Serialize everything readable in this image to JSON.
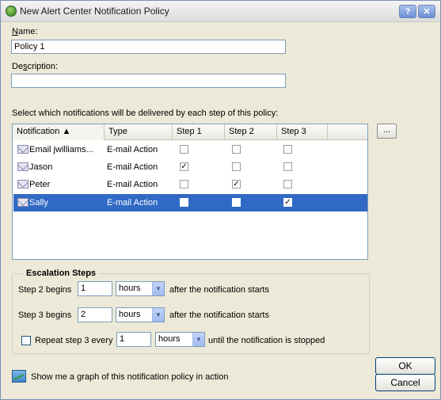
{
  "window": {
    "title": "New Alert Center Notification Policy",
    "help_label": "?",
    "close_label": "✕"
  },
  "name": {
    "label": "Name:",
    "value": "Policy 1"
  },
  "description": {
    "label": "Description:",
    "value": ""
  },
  "instructions": "Select which notifications will be delivered by each step of this policy:",
  "table": {
    "columns": [
      "Notification ▲",
      "Type",
      "Step 1",
      "Step 2",
      "Step 3"
    ],
    "rows": [
      {
        "name": "Email jwilliams...",
        "type": "E-mail Action",
        "step1": "",
        "step2": "",
        "step3": "",
        "selected": false
      },
      {
        "name": "Jason",
        "type": "E-mail Action",
        "step1": "✓",
        "step2": "",
        "step3": "",
        "selected": false
      },
      {
        "name": "Peter",
        "type": "E-mail Action",
        "step1": "",
        "step2": "✓",
        "step3": "",
        "selected": false
      },
      {
        "name": "Sally",
        "type": "E-mail Action",
        "step1": "",
        "step2": "",
        "step3": "✓",
        "selected": true
      }
    ]
  },
  "ellipsis_label": "...",
  "escalation": {
    "title": "Escalation Steps",
    "step2": {
      "label": "Step 2 begins",
      "value": "1",
      "unit": "hours",
      "suffix": "after the notification starts"
    },
    "step3": {
      "label": "Step 3 begins",
      "value": "2",
      "unit": "hours",
      "suffix": "after the notification starts"
    },
    "repeat": {
      "label": "Repeat step 3 every",
      "value": "1",
      "unit": "hours",
      "suffix": "until the notification is stopped",
      "checked": false
    }
  },
  "graph_link": "Show me a graph of this notification policy in action",
  "buttons": {
    "ok": "OK",
    "cancel": "Cancel"
  },
  "icons": {
    "app": "alert-center-icon",
    "row": "envelope-icon",
    "graph": "graph-icon"
  }
}
